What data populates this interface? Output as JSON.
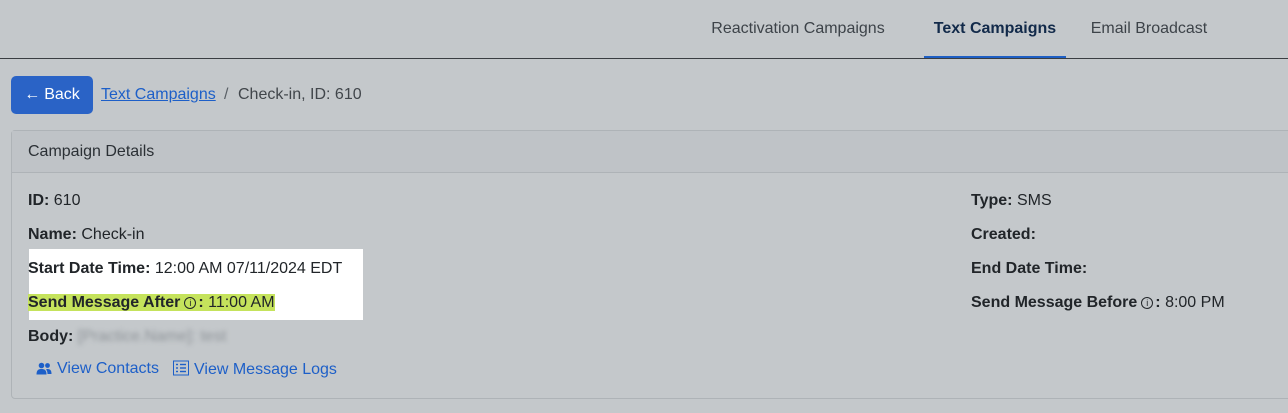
{
  "nav": {
    "tabs": [
      {
        "label": "Reactivation Campaigns"
      },
      {
        "label": "Text Campaigns"
      },
      {
        "label": "Email Broadcast"
      }
    ]
  },
  "breadcrumb": {
    "back_label": "Back",
    "link_label": "Text Campaigns",
    "separator": "/",
    "current": "Check-in, ID: 610"
  },
  "card": {
    "title": "Campaign Details",
    "left": {
      "id_label": "ID:",
      "id_value": "610",
      "name_label": "Name:",
      "name_value": "Check-in",
      "start_label": "Start Date Time:",
      "start_value": "12:00 AM 07/11/2024 EDT",
      "after_label": "Send Message After",
      "after_value": "11:00 AM",
      "body_label": "Body:",
      "body_value": "[Practice.Name]: test"
    },
    "right": {
      "type_label": "Type:",
      "type_value": "SMS",
      "created_label": "Created:",
      "end_label": "End Date Time:",
      "before_label": "Send Message Before",
      "before_value": "8:00 PM"
    },
    "actions": {
      "view_contacts": "View Contacts",
      "view_logs": "View Message Logs"
    }
  },
  "colors": {
    "accent": "#2a63c6",
    "highlight": "#c5e35c"
  }
}
